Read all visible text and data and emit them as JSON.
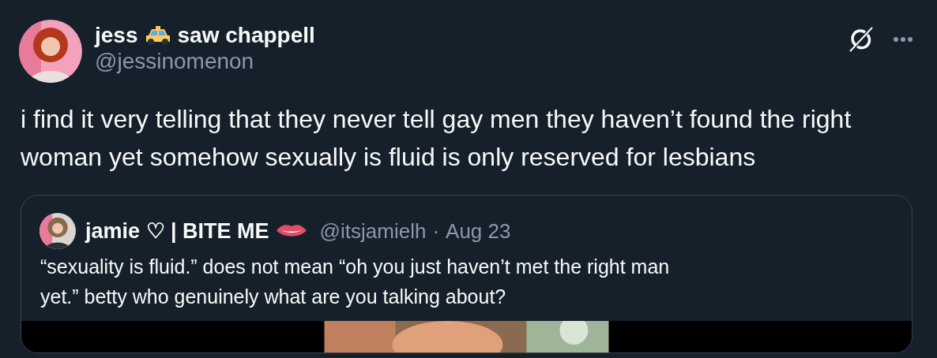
{
  "author": {
    "name_start": "jess",
    "name_end": "saw chappell",
    "handle": "@jessinomenon"
  },
  "text": "i find it very telling that they never tell gay men they haven’t found the right woman yet somehow sexually is fluid is only reserved for lesbians",
  "quote": {
    "name": "jamie ♡ | BITE ME",
    "handle": "@itsjamielh",
    "separator": "·",
    "date": "Aug 23",
    "text": "“sexuality is fluid.” does not mean “oh you just haven’t met the right man yet.” betty who genuinely what are you talking about?"
  }
}
